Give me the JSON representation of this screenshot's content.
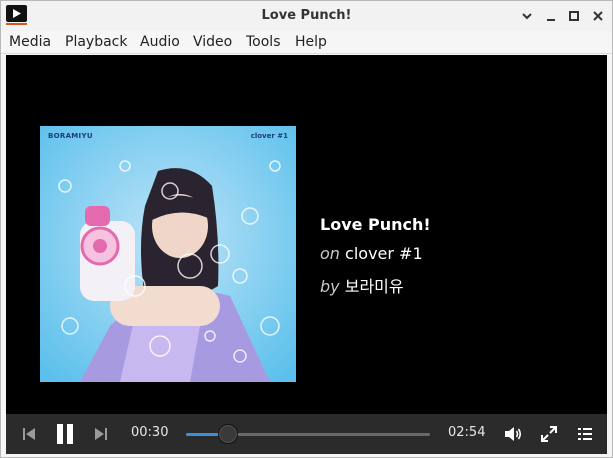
{
  "window": {
    "title": "Love Punch!",
    "icon": "vlc-video-player-icon"
  },
  "menu": {
    "items": [
      "Media",
      "Playback",
      "Audio",
      "Video",
      "Tools",
      "Help"
    ]
  },
  "cover": {
    "tag_left": "BORAMIYU",
    "tag_right": "clover #1"
  },
  "track": {
    "title": "Love Punch!",
    "album_prefix": "on",
    "album": "clover #1",
    "artist_prefix": "by",
    "artist": "보라미유"
  },
  "controls": {
    "elapsed": "00:30",
    "duration": "02:54",
    "progress": 0.172,
    "accent_color": "#3d8fd8"
  }
}
